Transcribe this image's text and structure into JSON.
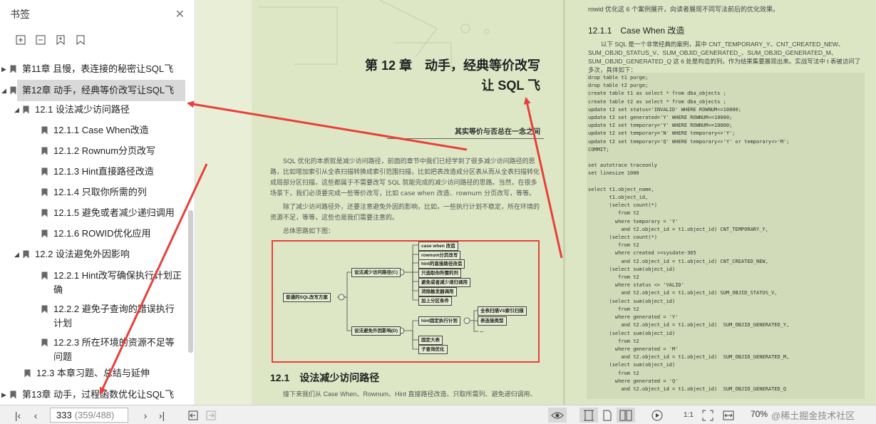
{
  "sidebar": {
    "title": "书签",
    "close_icon": "close-icon",
    "toolbar_icons": [
      "expand-all-icon",
      "collapse-all-icon",
      "add-bookmark-icon",
      "bookmark-icon"
    ],
    "items": [
      {
        "label": "第11章 且慢，表连接的秘密让SQL飞",
        "level": 0,
        "expander": "collapsed"
      },
      {
        "label": "第12章 动手，经典等价改写让SQL飞",
        "level": 0,
        "expander": "expanded",
        "selected": true
      },
      {
        "label": "12.1 设法减少访问路径",
        "level": 1,
        "expander": "expanded"
      },
      {
        "label": "12.1.1 Case When改造",
        "level": 2
      },
      {
        "label": "12.1.2 Rownum分页改写",
        "level": 2
      },
      {
        "label": "12.1.3 Hint直接路径改造",
        "level": 2
      },
      {
        "label": "12.1.4 只取你所需的列",
        "level": 2
      },
      {
        "label": "12.1.5 避免或者减少递归调用",
        "level": 2
      },
      {
        "label": "12.1.6 ROWID优化应用",
        "level": 2
      },
      {
        "label": "12.2 设法避免外因影响",
        "level": 1,
        "expander": "expanded"
      },
      {
        "label": "12.2.1 Hint改写确保执行计划正确",
        "level": 2
      },
      {
        "label": "12.2.2 避免子查询的错误执行计划",
        "level": 2
      },
      {
        "label": "12.2.3 所在环境的资源不足等问题",
        "level": 2
      },
      {
        "label": "12.3 本章习题、总结与延伸",
        "level": 1
      },
      {
        "label": "第13章 动手，过程函数优化让SQL飞",
        "level": 0,
        "expander": "collapsed"
      }
    ]
  },
  "left_page": {
    "chapter_title_line1": "第 12 章　动手，经典等价改写",
    "chapter_title_line2": "让 SQL 飞",
    "quote": "其实等价与否总在一念之间",
    "para1": "SQL 优化的本质就是减少访问路径，前面的章节中我们已经学到了很多减少访问路径的思路，比如增加索引从全表扫描转换成索引范围扫描，比如把表改造成分区表从而从全表扫描转化成局部分区扫描，这些都属于不需要改写 SQL 就能完成的减少访问路径的思路。当然，在很多场景下，我们必须要完成一些等价改写，比如 case when 改造、rownum 分页改写，等等。",
    "para2": "除了减少访问路径外，还要注意避免外因的影响，比如，一些执行计划不稳定，所在环境的资源不足，等等，这些也是我们需要注意的。",
    "para3": "总体思路如下图：",
    "mindmap": {
      "root": "普通的SQL改写方案",
      "branch1": "设法减少访问路径(C)",
      "branch1_items": [
        "case when 改造",
        "rownum分页改写",
        "hint的直接路径改造",
        "只选取你所需的列",
        "避免或者减少递归调用",
        "消除触发器调用",
        "加上分区条件"
      ],
      "branch2": "设法避免外因影响(D)",
      "branch2_item1": "hint固定执行计划",
      "branch2_item1_children": [
        "全表扫描VS索引扫描",
        "表连接类型",
        "..."
      ],
      "branch2_items": [
        "固定大表",
        "子查询优化"
      ]
    },
    "section_heading": "12.1　设法减少访问路径",
    "section_text": "接下来我们从 Case When、Rownum、Hint 直接路径改造、只取所需列、避免递归调用、"
  },
  "right_page": {
    "top_text": "rowid 优化这 6 个案例展开，向读者展现不同写法前后的优化效果。",
    "heading": "12.1.1　Case When 改造",
    "intro": "以下 SQL 是一个非常经典的案例，其中 CNT_TEMPORARY_Y、CNT_CREATED_NEW、SUM_OBJID_STATUS_V、SUM_OBJID_GENERATED_、SUM_OBJID_GENERATED_M、SUM_OBJID_GENERATED_Q 这 6 处是构造的列，作为结果集要展现出来。实战写法中 t 表被访问了多次，具体如下：",
    "code": "drop table t1 purge;\ndrop table t2 purge;\ncreate table t1 as select * from dba_objects ;\ncreate table t2 as select * from dba_objects ;\nupdate t2 set status='INVALID' WHERE ROWNUM<=10000;\nupdate t2 set generated='Y' WHERE ROWNUM<=10000;\nupdate t2 set temporary='Y' WHERE ROWNUM<=10000;\nupdate t2 set temporary='N' WHERE temporary<>'Y';\nupdate t2 set temporary='Q' WHERE temporary<>'Y' or temporary<>'M';\nCOMMIT;\n\nset autotrace traceonly\nset linesize 1000\n\nselect t1.object_name,\n       t1.object_id,\n       (select count(*)\n          from t2\n         where temporary = 'Y'\n           and t2.object_id = t1.object_id) CNT_TEMPORARY_Y,\n       (select count(*)\n          from t2\n         where created >=sysdate-365\n           and t2.object_id = t1.object_id) CNT_CREATED_NEW,\n       (select sum(object_id)\n          from t2\n         where status <> 'VALID'\n           and t2.object_id = t1.object_id) SUM_OBJID_STATUS_V,\n       (select sum(object_id)\n          from t2\n         where generated = 'Y'\n           and t2.object_id = t1.object_id)  SUM_OBJID_GENERATED_Y,\n       (select sum(object_id)\n          from t2\n         where generated = 'M'\n           and t2.object_id = t1.object_id)  SUM_OBJID_GENERATED_M,\n       (select sum(object_id)\n          from t2\n         where generated = 'Q'\n           and t2.object_id = t1.object_id)  SUM_OBJID_GENERATED_Q"
  },
  "bottombar": {
    "page_current": "333",
    "page_total": "(359/488)",
    "zoom": "70%",
    "watermark": "@稀土掘金技术社区",
    "icons": [
      "first-page-icon",
      "prev-page-icon",
      "next-page-icon",
      "last-page-icon",
      "back-icon",
      "forward-icon",
      "eye-icon",
      "single-page-icon",
      "continuous-page-icon",
      "two-page-icon",
      "play-icon",
      "actual-size-icon",
      "fit-page-icon",
      "fit-width-icon"
    ]
  },
  "colors": {
    "annotation_red": "#e8403a",
    "page_bg": "#dde7c6",
    "selected_row": "#d9d9d9"
  }
}
